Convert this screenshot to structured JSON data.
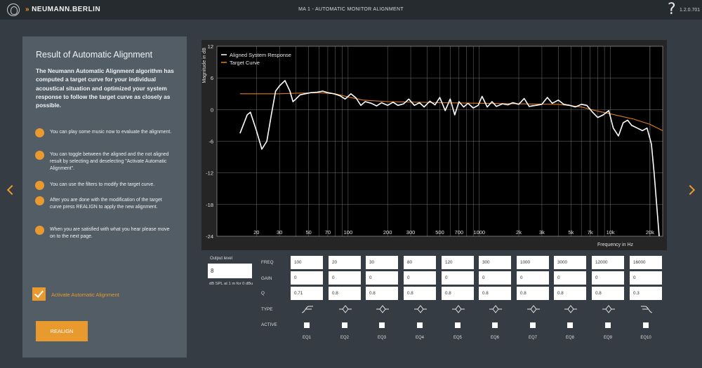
{
  "header": {
    "brand": "NEUMANN.BERLIN",
    "brand_arrows": "»",
    "title": "MA 1 - AUTOMATIC MONITOR ALIGNMENT",
    "help": "?",
    "version": "1.2.0.701"
  },
  "panel": {
    "title": "Result of Automatic Alignment",
    "description": "The Neumann Automatic Alignment algorithm has computed a target curve for your individual acoustical situation and optimized your system response to follow the target curve as closely as possible.",
    "tips": [
      "You can play some music now to evaluate the alignment.",
      "You can toggle between the aligned and the not aligned result by selecting and deselecting \"Activate Automatic Alignment\".",
      "You can use the filters to modify the target curve.",
      "After you are done with the modification of the target curve press REALIGN to apply the new alignment.",
      "When you are satisfied with what you hear please move on to the next page."
    ],
    "activate_label": "Activate Automatic Alignment",
    "activate_checked": true,
    "realign_label": "REALIGN"
  },
  "output_level": {
    "label": "Output level",
    "value": "8",
    "unit": "dB SPL at 1 m for 0 dBu"
  },
  "eq": {
    "row_labels": {
      "freq": "FREQ",
      "gain": "GAIN",
      "q": "Q",
      "type": "TYPE",
      "active": "ACTIVE"
    },
    "bands": [
      {
        "name": "EQ1",
        "freq": "100",
        "gain": "0",
        "q": "0.71",
        "type": "highpass",
        "active": false
      },
      {
        "name": "EQ2",
        "freq": "20",
        "gain": "0",
        "q": "0.8",
        "type": "peaking",
        "active": false
      },
      {
        "name": "EQ3",
        "freq": "30",
        "gain": "0",
        "q": "0.8",
        "type": "peaking",
        "active": false
      },
      {
        "name": "EQ4",
        "freq": "80",
        "gain": "0",
        "q": "0.8",
        "type": "peaking",
        "active": false
      },
      {
        "name": "EQ5",
        "freq": "120",
        "gain": "0",
        "q": "0.8",
        "type": "peaking",
        "active": false
      },
      {
        "name": "EQ6",
        "freq": "300",
        "gain": "0",
        "q": "0.8",
        "type": "peaking",
        "active": false
      },
      {
        "name": "EQ7",
        "freq": "1000",
        "gain": "0",
        "q": "0.8",
        "type": "peaking",
        "active": false
      },
      {
        "name": "EQ8",
        "freq": "3000",
        "gain": "0",
        "q": "0.8",
        "type": "peaking",
        "active": false
      },
      {
        "name": "EQ9",
        "freq": "12000",
        "gain": "0",
        "q": "0.8",
        "type": "peaking",
        "active": false
      },
      {
        "name": "EQ10",
        "freq": "16000",
        "gain": "0",
        "q": "0.3",
        "type": "lowpass",
        "active": false
      }
    ]
  },
  "colors": {
    "accent": "#e89a2e",
    "response": "#ffffff",
    "target": "#e07d1f",
    "plot_bg": "#000000"
  },
  "chart_data": {
    "type": "line",
    "xlabel": "Frequency in Hz",
    "ylabel": "Magnitude in dB",
    "xscale": "log",
    "xlim": [
      10,
      25000
    ],
    "ylim": [
      -24,
      12
    ],
    "yticks": [
      12,
      6,
      0,
      -6,
      -12,
      -18,
      -24
    ],
    "xticks": [
      {
        "value": 20,
        "label": "20"
      },
      {
        "value": 30,
        "label": "30"
      },
      {
        "value": 50,
        "label": "50"
      },
      {
        "value": 70,
        "label": "70"
      },
      {
        "value": 100,
        "label": "100"
      },
      {
        "value": 200,
        "label": "200"
      },
      {
        "value": 300,
        "label": "300"
      },
      {
        "value": 500,
        "label": "500"
      },
      {
        "value": 700,
        "label": "700"
      },
      {
        "value": 1000,
        "label": "1000"
      },
      {
        "value": 2000,
        "label": "2k"
      },
      {
        "value": 3000,
        "label": "3k"
      },
      {
        "value": 5000,
        "label": "5k"
      },
      {
        "value": 7000,
        "label": "7k"
      },
      {
        "value": 10000,
        "label": "10k"
      },
      {
        "value": 20000,
        "label": "20k"
      }
    ],
    "legend_position": "top-left",
    "grid": true,
    "series": [
      {
        "name": "Aligned System Response",
        "color": "#ffffff",
        "x": [
          15,
          17,
          18,
          20,
          22,
          24,
          26,
          28,
          30,
          33,
          36,
          38,
          40,
          43,
          47,
          52,
          58,
          64,
          70,
          78,
          87,
          95,
          105,
          115,
          125,
          135,
          150,
          165,
          180,
          200,
          220,
          240,
          265,
          290,
          320,
          350,
          380,
          420,
          460,
          500,
          550,
          600,
          650,
          700,
          760,
          820,
          900,
          980,
          1050,
          1150,
          1250,
          1350,
          1500,
          1650,
          1800,
          2000,
          2200,
          2400,
          2700,
          3000,
          3300,
          3600,
          4000,
          4400,
          4900,
          5400,
          6000,
          6600,
          7300,
          8000,
          8800,
          9700,
          10500,
          11500,
          12500,
          13500,
          14500,
          16000,
          17500,
          19000,
          20500,
          21500,
          22500,
          23500
        ],
        "y": [
          -4.5,
          -1,
          -0.5,
          -4,
          -7.5,
          -6,
          -1,
          3.5,
          4.5,
          5.5,
          3.5,
          1.5,
          2.0,
          2.8,
          3.0,
          3.2,
          3.3,
          3.5,
          3.2,
          3.0,
          2.6,
          2.0,
          3.0,
          2.2,
          0.8,
          1.5,
          1.2,
          0.7,
          1.3,
          0.8,
          1.4,
          0.8,
          1.1,
          2.0,
          0.8,
          1.3,
          0.5,
          1.6,
          0.9,
          2.3,
          -0.2,
          2.0,
          -1.0,
          1.5,
          0.5,
          1.2,
          0.3,
          0.8,
          2.5,
          0.5,
          1.5,
          0.6,
          1.1,
          0.9,
          1.3,
          1.0,
          2.1,
          0.6,
          0.8,
          1.0,
          2.3,
          1.2,
          1.8,
          1.0,
          0.8,
          0.5,
          1.0,
          0.8,
          -0.5,
          -1.5,
          -1.0,
          -0.2,
          -3.5,
          -5.0,
          -2.5,
          -2.0,
          -3.0,
          -3.5,
          -4.0,
          -3.5,
          -6.5,
          -12.0,
          -18.0,
          -24.0
        ]
      },
      {
        "name": "Target Curve",
        "color": "#e07d1f",
        "x": [
          15,
          30,
          40,
          60,
          80,
          100,
          130,
          200,
          500,
          1000,
          2000,
          4000,
          6000,
          8000,
          10000,
          15000,
          20000,
          25000
        ],
        "y": [
          3.0,
          3.0,
          3.1,
          3.2,
          3.0,
          2.4,
          1.8,
          1.5,
          1.3,
          1.2,
          1.1,
          1.0,
          0.5,
          -0.3,
          -0.8,
          -1.8,
          -2.8,
          -4.0
        ]
      }
    ]
  }
}
